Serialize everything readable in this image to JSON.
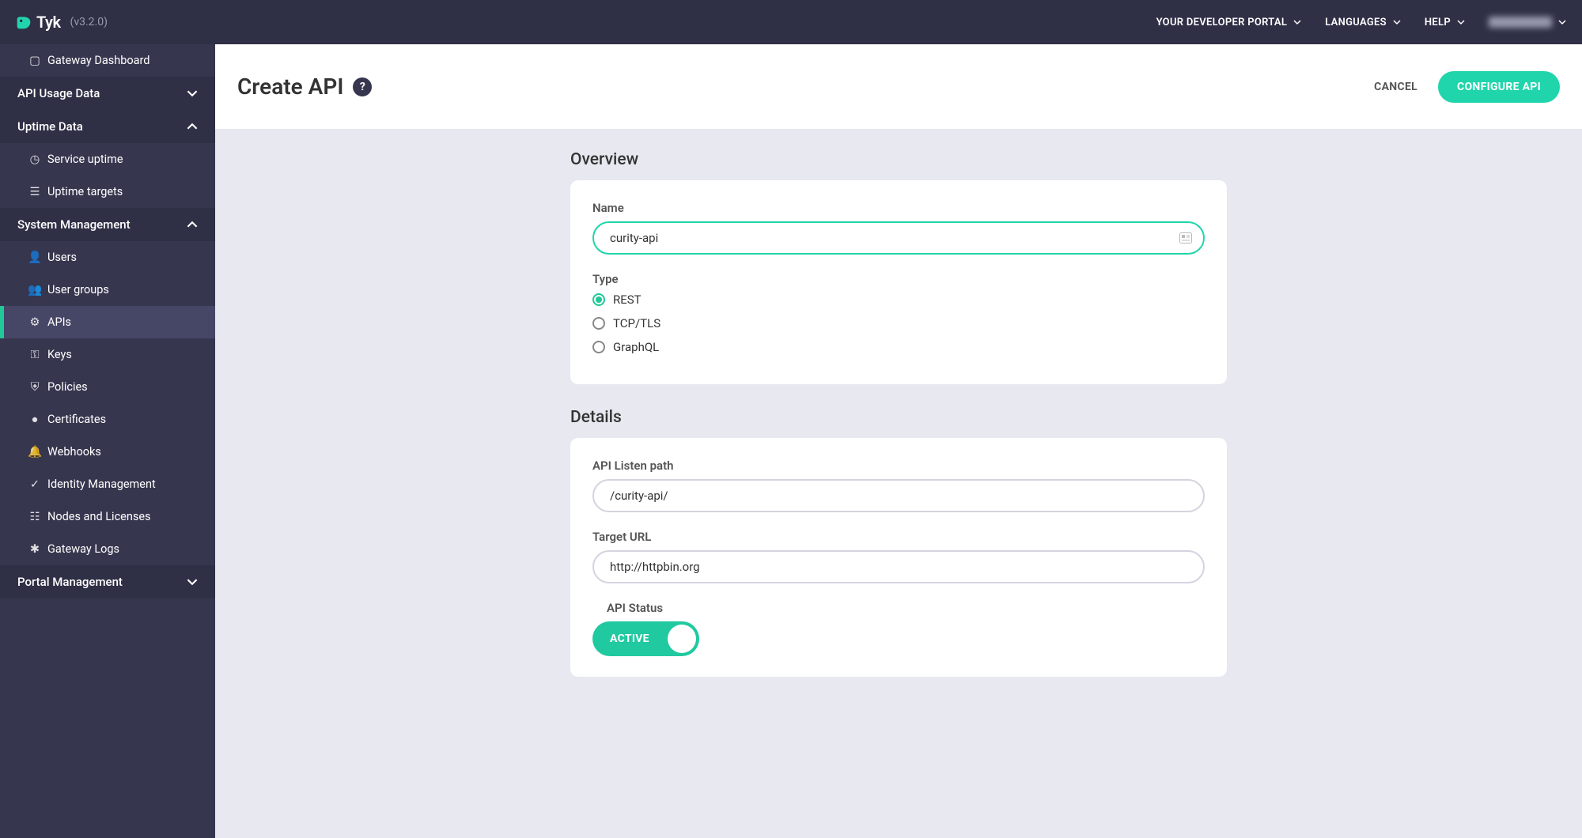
{
  "app": {
    "name": "Tyk",
    "version": "(v3.2.0)"
  },
  "topnav": {
    "portal": "YOUR DEVELOPER PORTAL",
    "languages": "LANGUAGES",
    "help": "HELP"
  },
  "sidebar": {
    "gateway_dashboard": "Gateway Dashboard",
    "api_usage": "API Usage Data",
    "uptime_data": "Uptime Data",
    "service_uptime": "Service uptime",
    "uptime_targets": "Uptime targets",
    "system_management": "System Management",
    "users": "Users",
    "user_groups": "User groups",
    "apis": "APIs",
    "keys": "Keys",
    "policies": "Policies",
    "certificates": "Certificates",
    "webhooks": "Webhooks",
    "identity_mgmt": "Identity Management",
    "nodes_licenses": "Nodes and Licenses",
    "gateway_logs": "Gateway Logs",
    "portal_management": "Portal Management"
  },
  "header": {
    "title": "Create API",
    "cancel": "CANCEL",
    "configure": "CONFIGURE API"
  },
  "overview": {
    "title": "Overview",
    "name_label": "Name",
    "name_value": "curity-api",
    "type_label": "Type",
    "types": {
      "rest": "REST",
      "tcp": "TCP/TLS",
      "graphql": "GraphQL"
    }
  },
  "details": {
    "title": "Details",
    "listen_label": "API Listen path",
    "listen_value": "/curity-api/",
    "target_label": "Target URL",
    "target_value": "http://httpbin.org",
    "status_label": "API Status",
    "status_value": "ACTIVE"
  }
}
